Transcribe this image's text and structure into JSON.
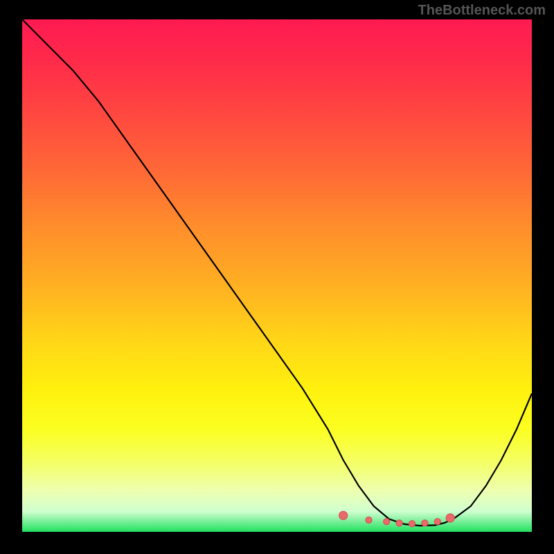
{
  "watermark": "TheBottleneck.com",
  "chart_data": {
    "type": "line",
    "title": "",
    "xlabel": "",
    "ylabel": "",
    "xlim": [
      0,
      100
    ],
    "ylim": [
      0,
      100
    ],
    "series": [
      {
        "name": "bottleneck-curve",
        "x": [
          0,
          5,
          10,
          15,
          20,
          25,
          30,
          35,
          40,
          45,
          50,
          55,
          60,
          63,
          66,
          69,
          72,
          75,
          78,
          81,
          83,
          85,
          88,
          91,
          94,
          97,
          100
        ],
        "values": [
          100,
          95,
          90,
          84,
          77,
          70,
          63,
          56,
          49,
          42,
          35,
          28,
          20,
          14,
          9,
          5,
          2.5,
          1.5,
          1.2,
          1.3,
          1.8,
          2.8,
          5,
          9,
          14,
          20,
          27
        ]
      }
    ],
    "markers": {
      "name": "optimal-range",
      "x": [
        63,
        68,
        71.5,
        74,
        76.5,
        79,
        81.5,
        84
      ],
      "values": [
        3.2,
        2.3,
        2.0,
        1.7,
        1.6,
        1.7,
        2.0,
        2.7
      ]
    },
    "gradient_stops": [
      {
        "pos": 0,
        "color": "#ff1a52"
      },
      {
        "pos": 50,
        "color": "#ffb022"
      },
      {
        "pos": 85,
        "color": "#fbff20"
      },
      {
        "pos": 100,
        "color": "#20e060"
      }
    ]
  }
}
